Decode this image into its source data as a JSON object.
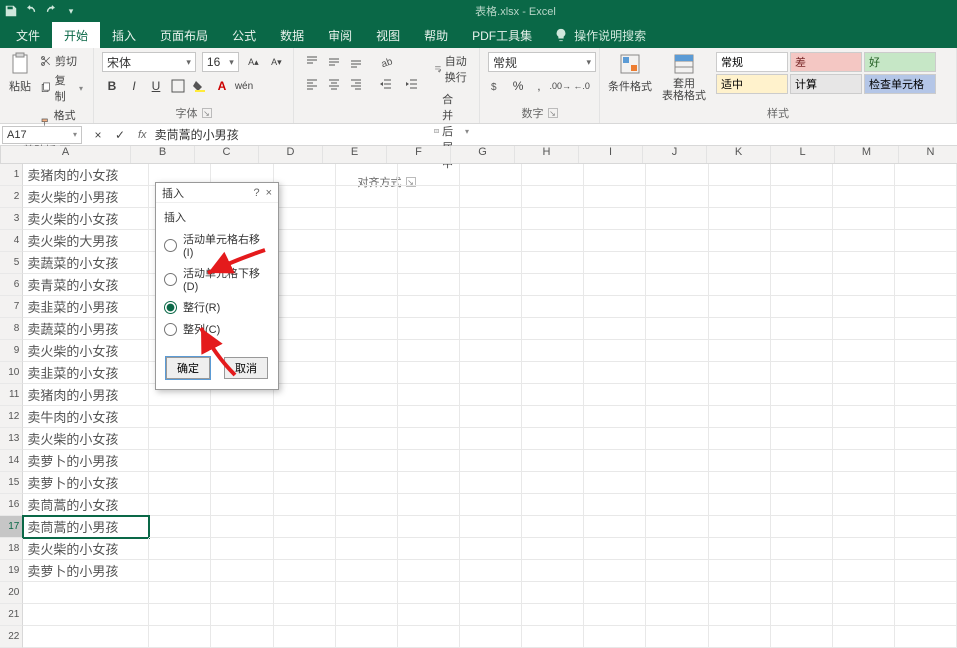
{
  "titlebar": {
    "title": "表格.xlsx - Excel"
  },
  "tabs": {
    "file": "文件",
    "home": "开始",
    "insert": "插入",
    "pagelayout": "页面布局",
    "formulas": "公式",
    "data": "数据",
    "review": "审阅",
    "view": "视图",
    "help": "帮助",
    "pdf": "PDF工具集",
    "tellme": "操作说明搜索"
  },
  "ribbon": {
    "clipboard": {
      "cut": "剪切",
      "copy": "复制",
      "formatpainter": "格式刷",
      "paste": "粘贴",
      "group": "剪贴板"
    },
    "font": {
      "name": "宋体",
      "size": "16",
      "bold": "B",
      "italic": "I",
      "underline": "U",
      "group": "字体"
    },
    "alignment": {
      "wrap": "自动换行",
      "merge": "合并后居中",
      "group": "对齐方式"
    },
    "number": {
      "format": "常规",
      "group": "数字"
    },
    "styles": {
      "condfmt": "条件格式",
      "tablefmt": "套用\n表格格式",
      "normal": "常规",
      "bad": "差",
      "good": "好",
      "neutral": "适中",
      "calc": "计算",
      "check": "检查单元格",
      "group": "样式"
    }
  },
  "namebox": "A17",
  "formula": "卖茼蒿的小男孩",
  "columns": [
    "A",
    "B",
    "C",
    "D",
    "E",
    "F",
    "G",
    "H",
    "I",
    "J",
    "K",
    "L",
    "M",
    "N"
  ],
  "colA_width": 130,
  "other_col_width": 64,
  "rows": [
    "卖猪肉的小女孩",
    "卖火柴的小男孩",
    "卖火柴的小女孩",
    "卖火柴的大男孩",
    "卖蔬菜的小女孩",
    "卖青菜的小女孩",
    "卖韭菜的小男孩",
    "卖蔬菜的小男孩",
    "卖火柴的小女孩",
    "卖韭菜的小女孩",
    "卖猪肉的小男孩",
    "卖牛肉的小女孩",
    "卖火柴的小女孩",
    "卖萝卜的小男孩",
    "卖萝卜的小女孩",
    "卖茼蒿的小女孩",
    "卖茼蒿的小男孩",
    "卖火柴的小女孩",
    "卖萝卜的小男孩"
  ],
  "selected_row": 17,
  "visible_extra_rows": 3,
  "dialog": {
    "title": "插入",
    "help": "?",
    "close": "×",
    "group": "插入",
    "opt_right": "活动单元格右移(I)",
    "opt_down": "活动单元格下移(D)",
    "opt_row": "整行(R)",
    "opt_col": "整列(C)",
    "selected": "opt_row",
    "ok": "确定",
    "cancel": "取消"
  }
}
